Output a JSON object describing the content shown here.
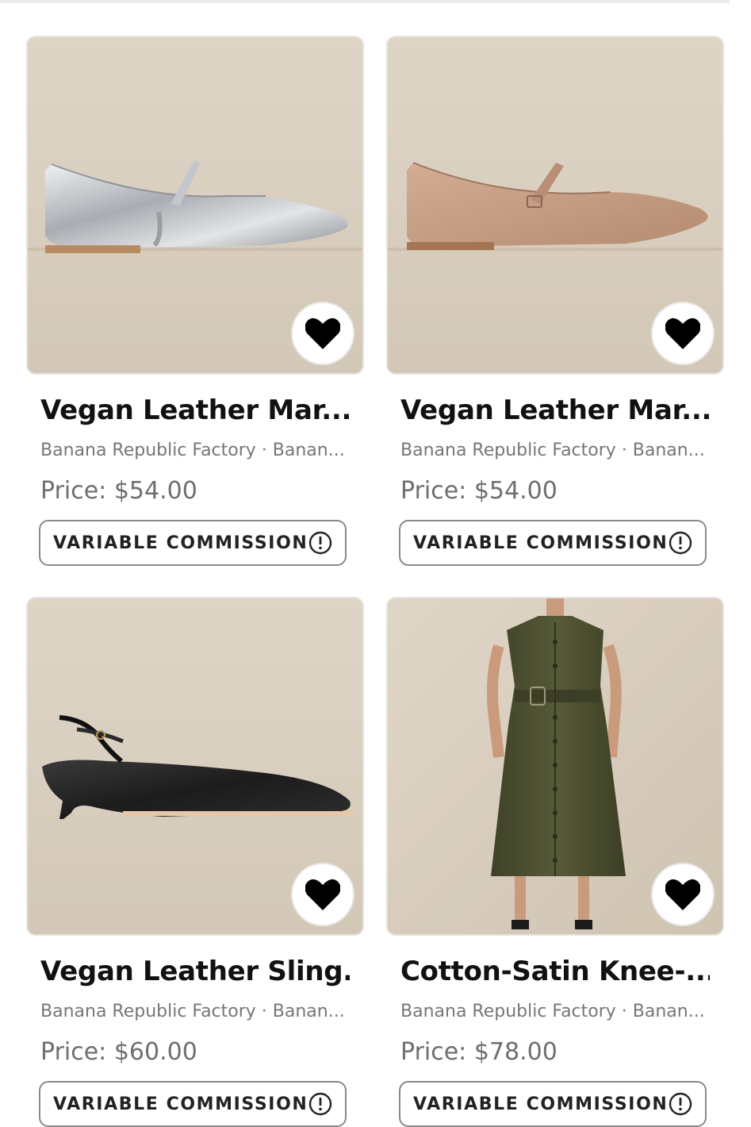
{
  "products": [
    {
      "title": "Vegan Leather Mar...",
      "brand": "Banana Republic Factory · Banan...",
      "price": "Price: $54.00",
      "commission_label": "VARIABLE COMMISSION",
      "image_icon": "silver-flat-shoe"
    },
    {
      "title": "Vegan Leather Mar...",
      "brand": "Banana Republic Factory · Banan...",
      "price": "Price: $54.00",
      "commission_label": "VARIABLE COMMISSION",
      "image_icon": "tan-flat-shoe"
    },
    {
      "title": "Vegan Leather Sling...",
      "brand": "Banana Republic Factory · Banan...",
      "price": "Price: $60.00",
      "commission_label": "VARIABLE COMMISSION",
      "image_icon": "black-slingback-shoe"
    },
    {
      "title": "Cotton-Satin Knee-...",
      "brand": "Banana Republic Factory · Banan...",
      "price": "Price: $78.00",
      "commission_label": "VARIABLE COMMISSION",
      "image_icon": "olive-dress"
    }
  ],
  "colors": {
    "image_background": "#d8cdbd",
    "silver": "#c9cbce",
    "tan": "#c79e84",
    "black": "#1c1c1c",
    "olive": "#4f5232"
  }
}
